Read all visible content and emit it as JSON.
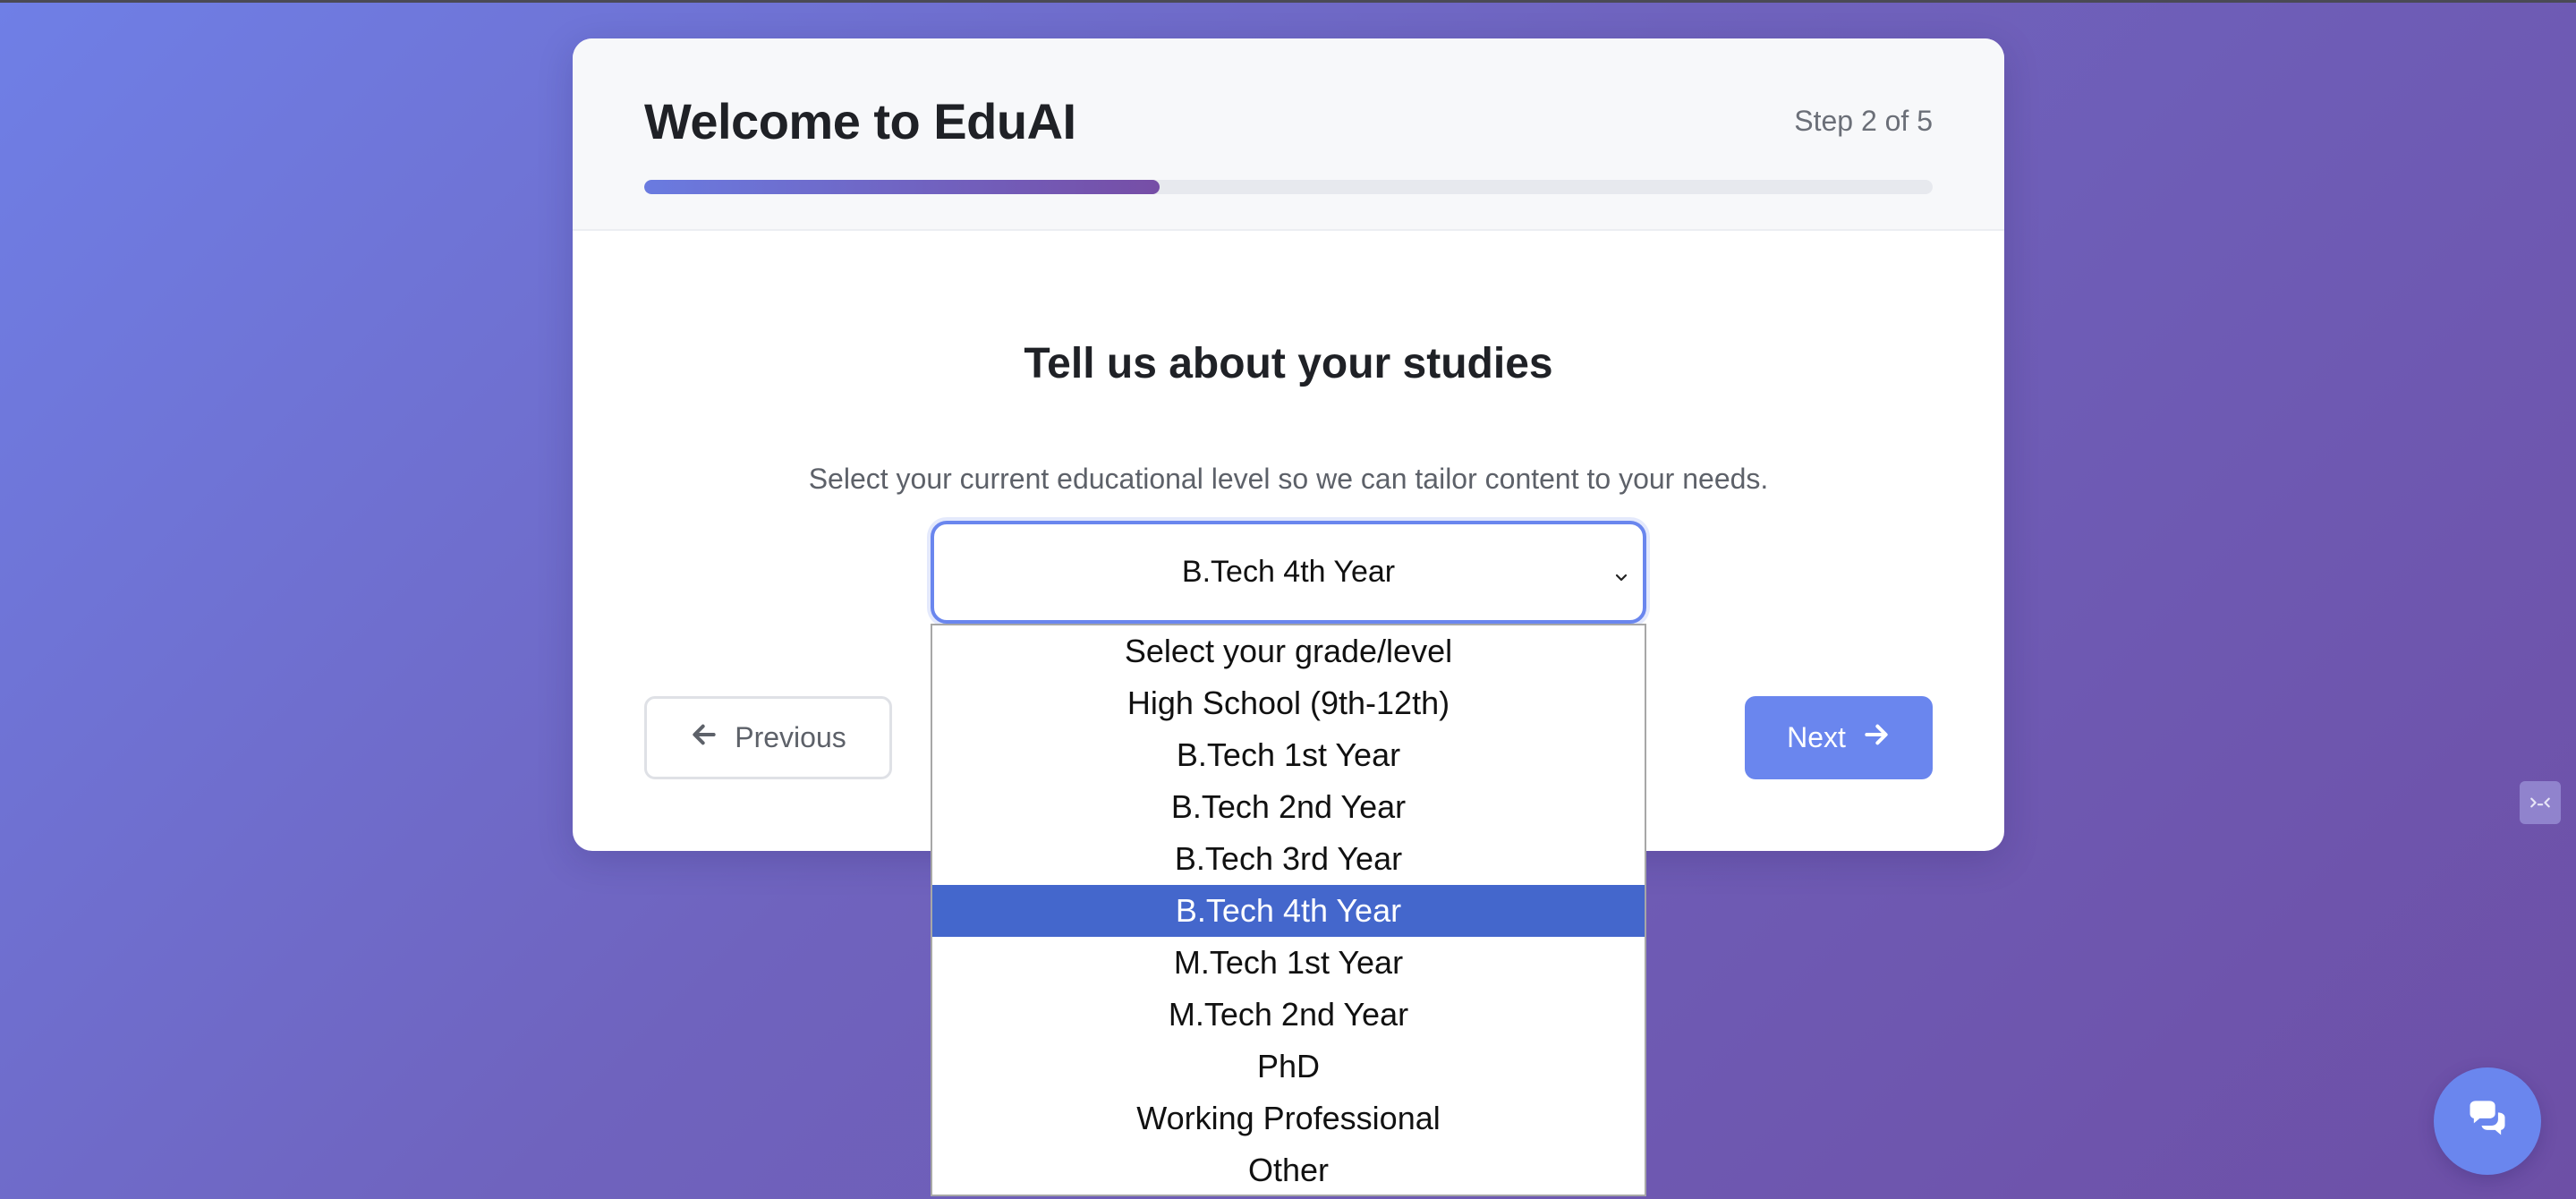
{
  "header": {
    "title": "Welcome to EduAI",
    "step_label": "Step 2 of 5",
    "progress": 0.4
  },
  "question": {
    "title": "Tell us about your studies",
    "description": "Select your current educational level so we can tailor content to your needs."
  },
  "level_select": {
    "selected_value": "B.Tech 4th Year",
    "options": [
      "Select your grade/level",
      "High School (9th-12th)",
      "B.Tech 1st Year",
      "B.Tech 2nd Year",
      "B.Tech 3rd Year",
      "B.Tech 4th Year",
      "M.Tech 1st Year",
      "M.Tech 2nd Year",
      "PhD",
      "Working Professional",
      "Other"
    ],
    "selected_index": 5
  },
  "navigation": {
    "previous_label": "Previous",
    "next_label": "Next"
  },
  "icons": {
    "previous": "arrow-left-icon",
    "next": "arrow-right-icon",
    "select": "chevron-down-icon",
    "chat": "chat-bubbles-icon",
    "side_widget": "code-icon"
  },
  "colors": {
    "accent": "#6a86ee",
    "progress_end": "#764ea6",
    "selected_option": "#4467cc"
  }
}
